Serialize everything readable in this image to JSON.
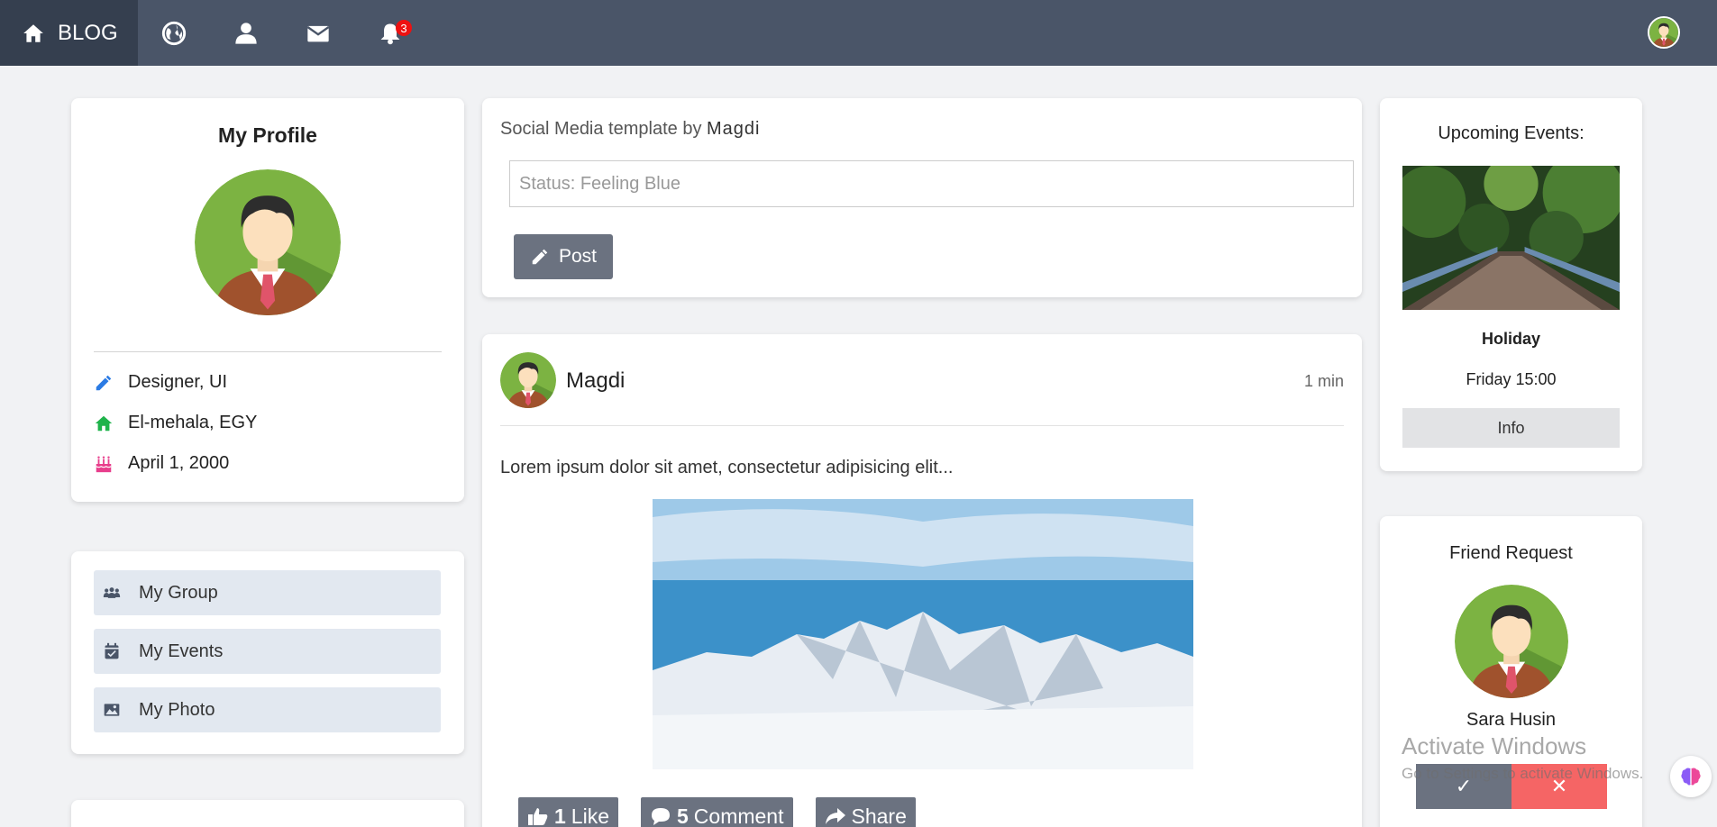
{
  "nav": {
    "brand": "BLOG",
    "notifications_count": "3",
    "icons": [
      "home-icon",
      "globe-icon",
      "user-icon",
      "mail-icon",
      "bell-icon"
    ]
  },
  "profile": {
    "title": "My Profile",
    "role": "Designer, UI",
    "location": "El-mehala, EGY",
    "birthday": "April 1, 2000",
    "colors": {
      "role_icon": "#2b7be4",
      "location_icon": "#1fb34b",
      "birthday_icon": "#e83e8c"
    }
  },
  "menu": {
    "items": [
      {
        "label": "My Group",
        "icon": "group-icon"
      },
      {
        "label": "My Events",
        "icon": "calendar-check-icon"
      },
      {
        "label": "My Photo",
        "icon": "image-icon"
      }
    ]
  },
  "composer": {
    "title_prefix": "Social Media template by",
    "title_author": "Magdi",
    "status_placeholder": "Status: Feeling Blue",
    "post_label": "Post"
  },
  "post": {
    "author": "Magdi",
    "time": "1 min",
    "text": "Lorem ipsum dolor sit amet, consectetur adipisicing elit...",
    "like_count": "1",
    "like_label": "Like",
    "comment_count": "5",
    "comment_label": "Comment",
    "share_label": "Share"
  },
  "events": {
    "title": "Upcoming Events:",
    "name": "Holiday",
    "time": "Friday 15:00",
    "info_label": "Info"
  },
  "friend_request": {
    "title": "Friend Request",
    "name": "Sara Husin",
    "accept_symbol": "✓",
    "decline_symbol": "✕"
  },
  "system": {
    "watermark_title": "Activate Windows",
    "watermark_sub": "Go to Settings to activate Windows."
  }
}
